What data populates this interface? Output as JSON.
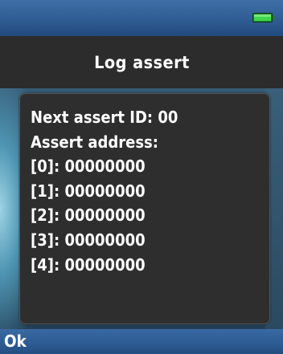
{
  "status_bar": {
    "battery_icon": "battery-full-icon",
    "battery_color": "#2fbf3a"
  },
  "header": {
    "title": "Log assert"
  },
  "panel": {
    "lines": [
      "Next assert ID: 00",
      "Assert address:",
      "[0]: 00000000",
      "[1]: 00000000",
      "[2]: 00000000",
      "[3]: 00000000",
      "[4]: 00000000"
    ]
  },
  "softkeys": {
    "left_label": "Ok"
  },
  "colors": {
    "title_bar_bg": "#2c2c2c",
    "panel_bg": "#2e2e2e",
    "bar_blue": "#2f5c94",
    "text": "#ffffff"
  }
}
